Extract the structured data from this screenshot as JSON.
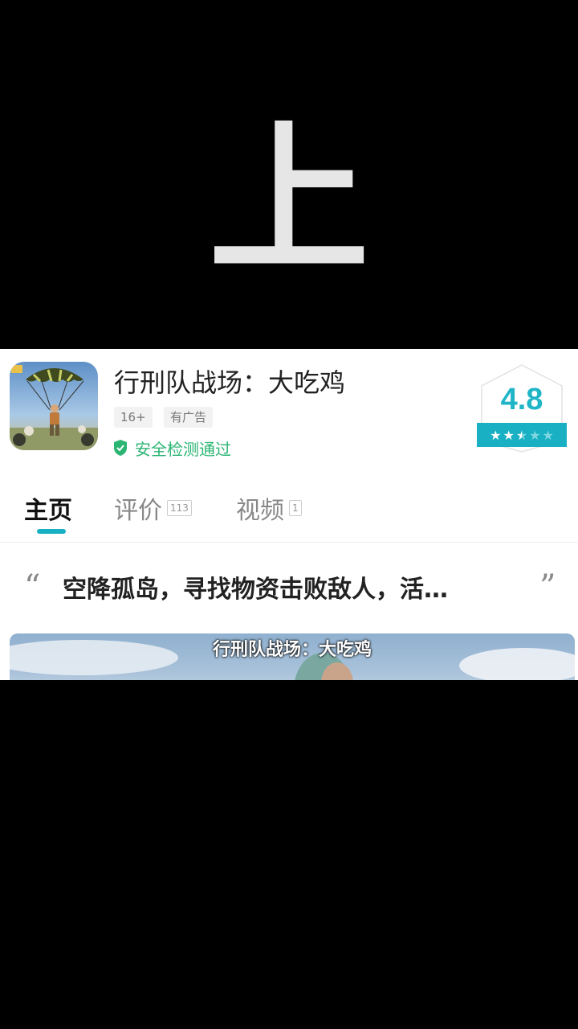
{
  "overlay": {
    "big_character": "上"
  },
  "app": {
    "title": "行刑队战场：大吃鸡",
    "tags": [
      "16+",
      "有广告"
    ],
    "safety_text": "安全检测通过",
    "rating": "4.8",
    "rating_stars": 2.5,
    "icon": "app-icon-parachute-soldier"
  },
  "tabs": [
    {
      "label": "主页",
      "count": "",
      "active": true
    },
    {
      "label": "评价",
      "count": "113",
      "active": false
    },
    {
      "label": "视频",
      "count": "1",
      "active": false
    }
  ],
  "quote": {
    "open": "“",
    "close": "”",
    "text": "空降孤岛，寻找物资击败敌人，活…"
  },
  "video": {
    "caption": "行刑队战场：大吃鸡"
  },
  "colors": {
    "accent": "#19b0c3",
    "safe_green": "#2bb573",
    "background_dark": "#000000"
  }
}
